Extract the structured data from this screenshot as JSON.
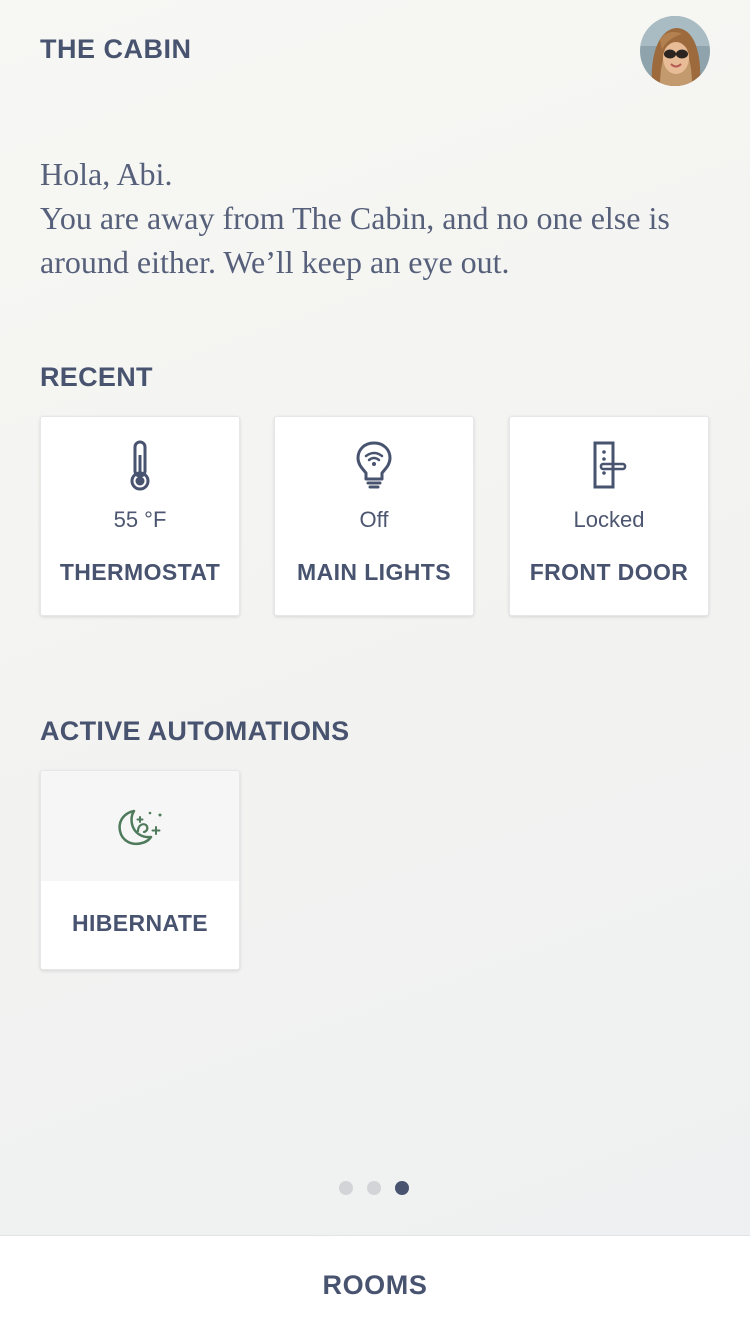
{
  "header": {
    "title": "THE CABIN",
    "avatar_icon": "user-avatar"
  },
  "greeting": {
    "line1": "Hola, Abi.",
    "line2": "You are away from The Cabin, and no one else is around either. We’ll keep an eye out."
  },
  "recent": {
    "title": "RECENT",
    "devices": [
      {
        "icon": "thermometer-icon",
        "value": "55 °F",
        "label": "THERMOSTAT"
      },
      {
        "icon": "lightbulb-icon",
        "value": "Off",
        "label": "MAIN LIGHTS"
      },
      {
        "icon": "door-lock-icon",
        "value": "Locked",
        "label": "FRONT DOOR"
      }
    ]
  },
  "automations": {
    "title": "ACTIVE AUTOMATIONS",
    "items": [
      {
        "icon": "moon-stars-icon",
        "label": "HIBERNATE"
      }
    ]
  },
  "pagination": {
    "count": 3,
    "active_index": 2
  },
  "bottom_nav": {
    "label": "ROOMS"
  },
  "colors": {
    "text": "#48536f",
    "automation_icon": "#4f7a5c",
    "dot_inactive": "#d2d4d8",
    "dot_active": "#48536f"
  }
}
